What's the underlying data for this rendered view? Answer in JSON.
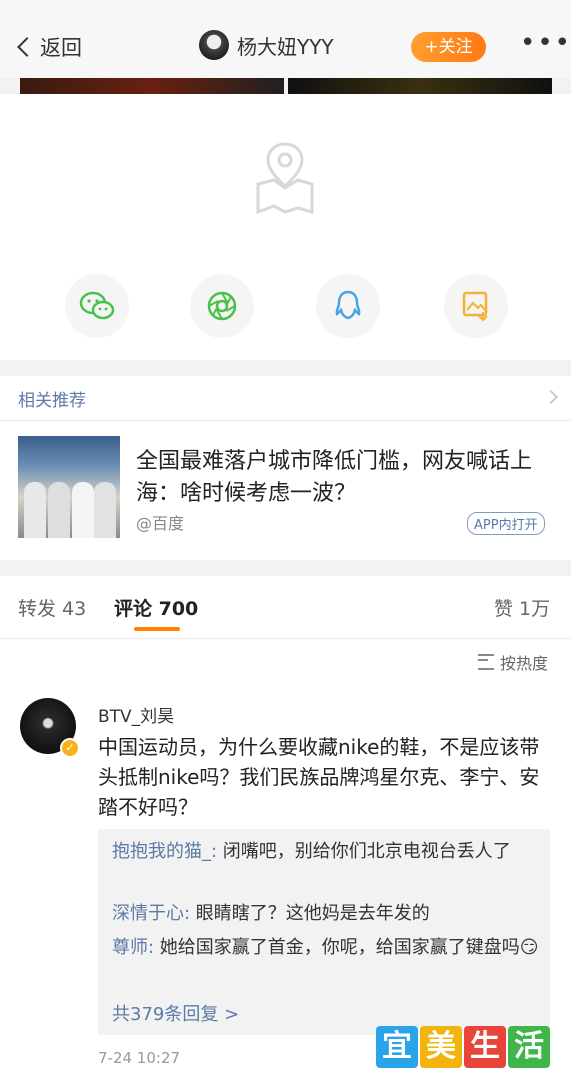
{
  "header": {
    "back_label": "返回",
    "username": "杨大妞YYY",
    "follow_label": "+关注",
    "more_label": "•••"
  },
  "share": {
    "icons": [
      "wechat-icon",
      "moments-icon",
      "qq-icon",
      "save-image-icon"
    ],
    "colors": [
      "#4cc04c",
      "#4cc04c",
      "#4aa3e6",
      "#f2b233"
    ]
  },
  "recommend": {
    "title": "相关推荐",
    "headline": "全国最难落户城市降低门槛，网友喊话上海：啥时候考虑一波？",
    "source": "@百度",
    "open_tag": "APP内打开"
  },
  "tabs": {
    "repost": "转发 43",
    "comments": "评论 700",
    "likes": "赞 1万"
  },
  "sort_label": "按热度",
  "comment": {
    "author": "BTV_刘昊",
    "text": "中国运动员，为什么要收藏nike的鞋，不是应该带头抵制nike吗？我们民族品牌鸿星尔克、李宁、安踏不好吗？",
    "replies": [
      {
        "user": "抱抱我的猫_:",
        "text": " 闭嘴吧，别给你们北京电视台丢人了"
      },
      {
        "user": "深情于心:",
        "text": " 眼睛瞎了？这他妈是去年发的"
      },
      {
        "user": "尊师:",
        "text": " 她给国家赢了首金，你呢，给国家赢了键盘吗😏"
      }
    ],
    "more_replies": "共379条回复 >",
    "time": "7-24 10:27"
  },
  "watermark": {
    "chars": [
      "宜",
      "美",
      "生",
      "活"
    ],
    "colors": [
      "#2aa4e8",
      "#f2b40c",
      "#e8443a",
      "#3fb54a"
    ]
  }
}
